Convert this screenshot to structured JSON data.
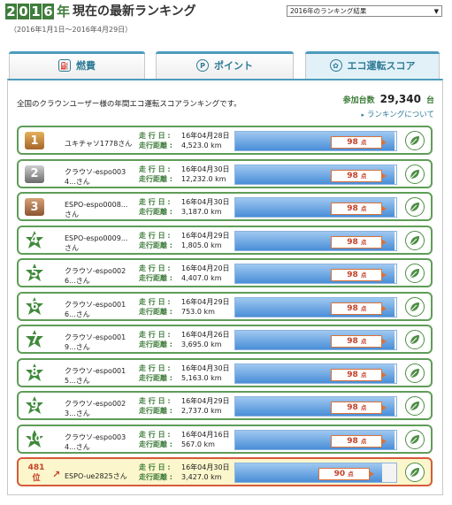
{
  "header": {
    "year_digits": [
      "2",
      "0",
      "1",
      "6"
    ],
    "year_kanji": "年",
    "title": "現在の最新ランキング",
    "period": "（2016年1月1日〜2016年4月29日）",
    "select_value": "2016年のランキング結果"
  },
  "tabs": [
    {
      "label": "燃費",
      "active": false
    },
    {
      "label": "ポイント",
      "active": false
    },
    {
      "label": "エコ運転スコア",
      "active": true
    }
  ],
  "intro": "全国のクラウンユーザー様の年間エコ運転スコアランキングです。",
  "participants": {
    "label": "参加台数",
    "value": "29,340",
    "unit": "台"
  },
  "about_link": "ランキングについて",
  "field_labels": {
    "days": "走 行 日 :",
    "distance": "走行距離 :"
  },
  "score_unit": "点",
  "rows": [
    {
      "rank": "1",
      "badge": "medal-gold",
      "name": "ユキチャソ1778さん",
      "date": "16年04月28日",
      "distance": "4,523.0 km",
      "score": "98",
      "score_fraction": 0.98
    },
    {
      "rank": "2",
      "badge": "medal-silver",
      "name": "クラウソ-espo0034...さん",
      "date": "16年04月30日",
      "distance": "12,232.0 km",
      "score": "98",
      "score_fraction": 0.98
    },
    {
      "rank": "3",
      "badge": "medal-bronze",
      "name": "ESPO-espo0008...さん",
      "date": "16年04月30日",
      "distance": "3,187.0 km",
      "score": "98",
      "score_fraction": 0.98
    },
    {
      "rank": "4",
      "badge": "star",
      "name": "ESPO-espo0009...さん",
      "date": "16年04月29日",
      "distance": "1,805.0 km",
      "score": "98",
      "score_fraction": 0.98
    },
    {
      "rank": "5",
      "badge": "star",
      "name": "クラウソ-espo0026...さん",
      "date": "16年04月20日",
      "distance": "4,407.0 km",
      "score": "98",
      "score_fraction": 0.98
    },
    {
      "rank": "6",
      "badge": "star",
      "name": "クラウソ-espo0016...さん",
      "date": "16年04月29日",
      "distance": "753.0 km",
      "score": "98",
      "score_fraction": 0.98
    },
    {
      "rank": "7",
      "badge": "star",
      "name": "クラウソ-espo0019...さん",
      "date": "16年04月26日",
      "distance": "3,695.0 km",
      "score": "98",
      "score_fraction": 0.98
    },
    {
      "rank": "8",
      "badge": "star",
      "name": "クラウソ-espo0015...さん",
      "date": "16年04月30日",
      "distance": "5,163.0 km",
      "score": "98",
      "score_fraction": 0.98
    },
    {
      "rank": "9",
      "badge": "star",
      "name": "クラウソ-espo0023...さん",
      "date": "16年04月29日",
      "distance": "2,737.0 km",
      "score": "98",
      "score_fraction": 0.98
    },
    {
      "rank": "10",
      "badge": "star",
      "name": "クラウソ-espo0034...さん",
      "date": "16年04月16日",
      "distance": "567.0 km",
      "score": "98",
      "score_fraction": 0.98
    }
  ],
  "my_row": {
    "rank": "481",
    "rank_suffix": "位",
    "trend_icon": "arrow-up-right-icon",
    "name": "ESPO-ue2825さん",
    "date": "16年04月30日",
    "distance": "3,427.0 km",
    "score": "90",
    "score_fraction": 0.9
  },
  "colors": {
    "green": "#3f7d3c",
    "blue": "#4d9bbd",
    "accent": "#c54128"
  }
}
